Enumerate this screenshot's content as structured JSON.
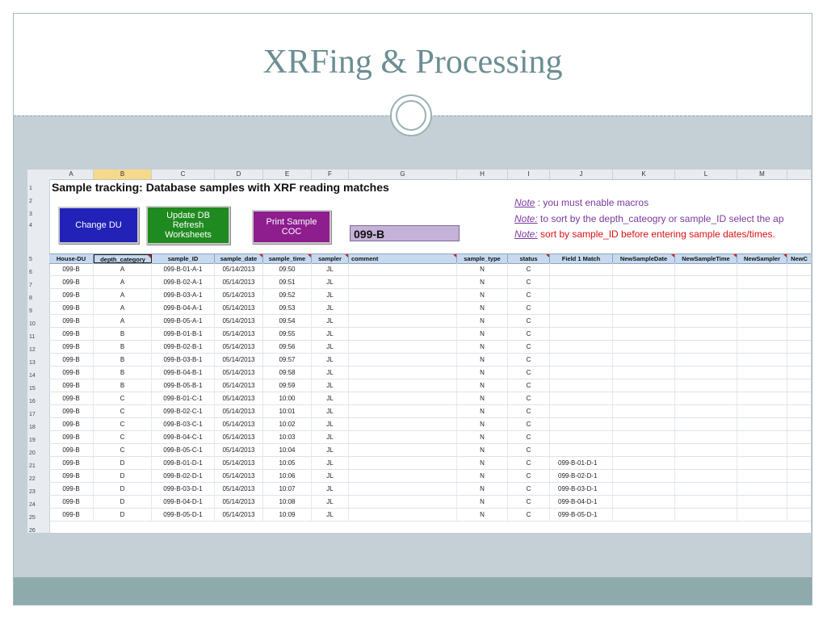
{
  "slide": {
    "title": "XRFing & Processing"
  },
  "sheet": {
    "columns": [
      "A",
      "B",
      "C",
      "D",
      "E",
      "F",
      "G",
      "H",
      "I",
      "J",
      "K",
      "L",
      "M"
    ],
    "row_numbers": [
      "1",
      "2",
      "3",
      "4",
      "5",
      "6",
      "7",
      "8",
      "9",
      "10",
      "11",
      "12",
      "13",
      "14",
      "15",
      "16",
      "17",
      "18",
      "19",
      "20",
      "21",
      "22",
      "23",
      "24",
      "25",
      "26"
    ],
    "heading": "Sample tracking: Database samples with XRF reading matches",
    "buttons": {
      "change_du": "Change DU",
      "update_db": "Update DB Refresh Worksheets",
      "print_coc": "Print Sample COC"
    },
    "du_value": "099-B",
    "notes": [
      {
        "label": "Note",
        "sep": " :",
        "text": " you must enable macros"
      },
      {
        "label": "Note:",
        "sep": "",
        "text": " to sort by the depth_cateogry or sample_ID select the ap"
      },
      {
        "label": "Note:",
        "sep": "",
        "text": " sort by sample_ID before entering sample dates/times."
      }
    ],
    "headers": [
      "House-DU",
      "depth_category",
      "sample_ID",
      "sample_date",
      "sample_time",
      "sampler",
      "comment",
      "sample_type",
      "status",
      "Field 1 Match",
      "NewSampleDate",
      "NewSampleTime",
      "NewSampler",
      "NewC"
    ],
    "rows": [
      [
        "099-B",
        "A",
        "099-B-01-A-1",
        "05/14/2013",
        "09:50",
        "JL",
        "",
        "N",
        "C",
        ""
      ],
      [
        "099-B",
        "A",
        "099-B-02-A-1",
        "05/14/2013",
        "09:51",
        "JL",
        "",
        "N",
        "C",
        ""
      ],
      [
        "099-B",
        "A",
        "099-B-03-A-1",
        "05/14/2013",
        "09:52",
        "JL",
        "",
        "N",
        "C",
        ""
      ],
      [
        "099-B",
        "A",
        "099-B-04-A-1",
        "05/14/2013",
        "09:53",
        "JL",
        "",
        "N",
        "C",
        ""
      ],
      [
        "099-B",
        "A",
        "099-B-05-A-1",
        "05/14/2013",
        "09:54",
        "JL",
        "",
        "N",
        "C",
        ""
      ],
      [
        "099-B",
        "B",
        "099-B-01-B-1",
        "05/14/2013",
        "09:55",
        "JL",
        "",
        "N",
        "C",
        ""
      ],
      [
        "099-B",
        "B",
        "099-B-02-B-1",
        "05/14/2013",
        "09:56",
        "JL",
        "",
        "N",
        "C",
        ""
      ],
      [
        "099-B",
        "B",
        "099-B-03-B-1",
        "05/14/2013",
        "09:57",
        "JL",
        "",
        "N",
        "C",
        ""
      ],
      [
        "099-B",
        "B",
        "099-B-04-B-1",
        "05/14/2013",
        "09:58",
        "JL",
        "",
        "N",
        "C",
        ""
      ],
      [
        "099-B",
        "B",
        "099-B-05-B-1",
        "05/14/2013",
        "09:59",
        "JL",
        "",
        "N",
        "C",
        ""
      ],
      [
        "099-B",
        "C",
        "099-B-01-C-1",
        "05/14/2013",
        "10:00",
        "JL",
        "",
        "N",
        "C",
        ""
      ],
      [
        "099-B",
        "C",
        "099-B-02-C-1",
        "05/14/2013",
        "10:01",
        "JL",
        "",
        "N",
        "C",
        ""
      ],
      [
        "099-B",
        "C",
        "099-B-03-C-1",
        "05/14/2013",
        "10:02",
        "JL",
        "",
        "N",
        "C",
        ""
      ],
      [
        "099-B",
        "C",
        "099-B-04-C-1",
        "05/14/2013",
        "10:03",
        "JL",
        "",
        "N",
        "C",
        ""
      ],
      [
        "099-B",
        "C",
        "099-B-05-C-1",
        "05/14/2013",
        "10:04",
        "JL",
        "",
        "N",
        "C",
        ""
      ],
      [
        "099-B",
        "D",
        "099-B-01-D-1",
        "05/14/2013",
        "10:05",
        "JL",
        "",
        "N",
        "C",
        "099-B-01-D-1"
      ],
      [
        "099-B",
        "D",
        "099-B-02-D-1",
        "05/14/2013",
        "10:06",
        "JL",
        "",
        "N",
        "C",
        "099-B-02-D-1"
      ],
      [
        "099-B",
        "D",
        "099-B-03-D-1",
        "05/14/2013",
        "10:07",
        "JL",
        "",
        "N",
        "C",
        "099-B-03-D-1"
      ],
      [
        "099-B",
        "D",
        "099-B-04-D-1",
        "05/14/2013",
        "10:08",
        "JL",
        "",
        "N",
        "C",
        "099-B-04-D-1"
      ],
      [
        "099-B",
        "D",
        "099-B-05-D-1",
        "05/14/2013",
        "10:09",
        "JL",
        "",
        "N",
        "C",
        "099-B-05-D-1"
      ]
    ]
  },
  "colors": {
    "title": "#6b8e93",
    "header_fill": "#c6d9ee",
    "du_fill": "#c4b2d8",
    "note_purple": "#7a3aa0",
    "note_red": "#d91010"
  }
}
